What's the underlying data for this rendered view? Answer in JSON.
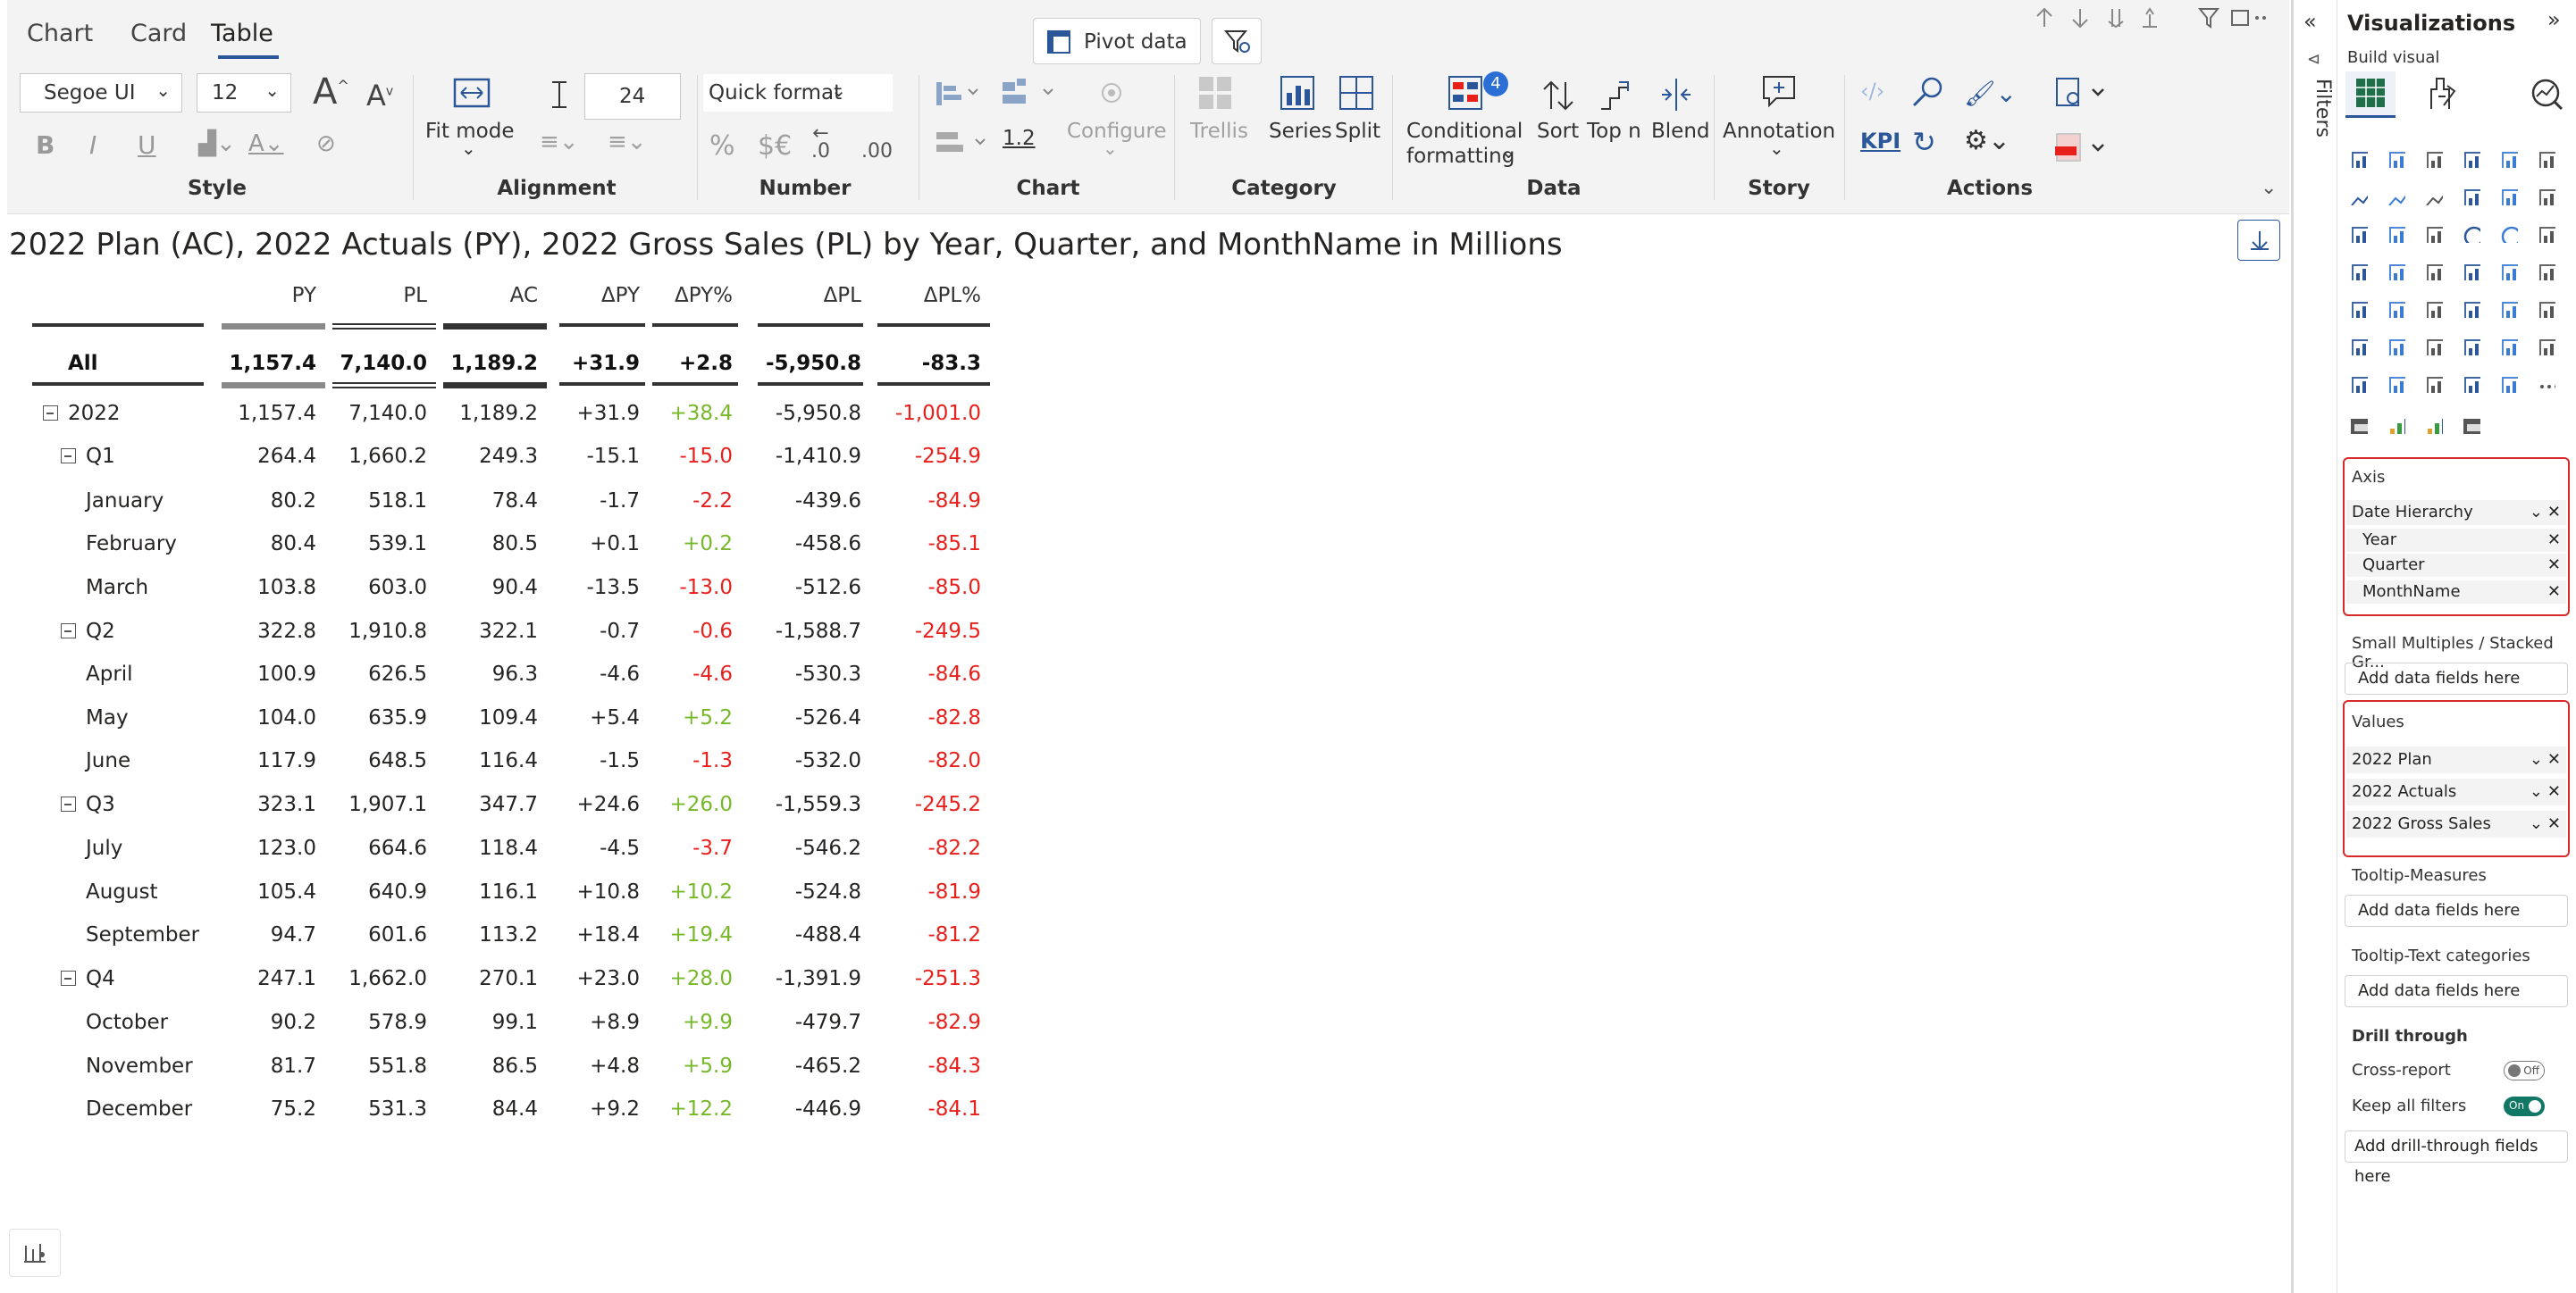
{
  "tabs": [
    "Chart",
    "Card",
    "Table"
  ],
  "active_tab": "Table",
  "top_buttons": {
    "pivot": "Pivot data"
  },
  "ribbon": {
    "style": {
      "font": "Segoe UI",
      "size": "12",
      "group": "Style"
    },
    "alignment": {
      "row_height": "24",
      "fit_mode": "Fit mode",
      "group": "Alignment"
    },
    "number": {
      "quick_format": "Quick format",
      "percent": "%",
      "currency": "$€",
      "dec_dec": ".0",
      "dec_inc": ".00",
      "group": "Number"
    },
    "chart": {
      "scale": "1.2",
      "configure": "Configure",
      "group": "Chart"
    },
    "category": {
      "trellis": "Trellis",
      "series": "Series",
      "split": "Split",
      "group": "Category"
    },
    "data": {
      "conditional": "Conditional",
      "formatting": "formatting",
      "badge": "4",
      "sort": "Sort",
      "topn": "Top n",
      "blend": "Blend",
      "group": "Data"
    },
    "story": {
      "annotation": "Annotation",
      "group": "Story"
    },
    "actions": {
      "kpi": "KPI",
      "group": "Actions"
    }
  },
  "visual_title": "2022 Plan (AC), 2022 Actuals (PY), 2022 Gross Sales (PL) by Year, Quarter, and MonthName in Millions",
  "table": {
    "columns": [
      "PY",
      "PL",
      "AC",
      "ΔPY",
      "ΔPY%",
      "ΔPL",
      "ΔPL%"
    ],
    "rows": [
      {
        "label": "All",
        "level": "total",
        "values": [
          "1,157.4",
          "7,140.0",
          "1,189.2",
          "+31.9",
          "+2.8",
          "-5,950.8",
          "-83.3"
        ]
      },
      {
        "label": "2022",
        "level": "year",
        "values": [
          "1,157.4",
          "7,140.0",
          "1,189.2",
          "+31.9",
          "+38.4",
          "-5,950.8",
          "-1,001.0"
        ]
      },
      {
        "label": "Q1",
        "level": "quarter",
        "values": [
          "264.4",
          "1,660.2",
          "249.3",
          "-15.1",
          "-15.0",
          "-1,410.9",
          "-254.9"
        ]
      },
      {
        "label": "January",
        "level": "month",
        "values": [
          "80.2",
          "518.1",
          "78.4",
          "-1.7",
          "-2.2",
          "-439.6",
          "-84.9"
        ]
      },
      {
        "label": "February",
        "level": "month",
        "values": [
          "80.4",
          "539.1",
          "80.5",
          "+0.1",
          "+0.2",
          "-458.6",
          "-85.1"
        ]
      },
      {
        "label": "March",
        "level": "month",
        "values": [
          "103.8",
          "603.0",
          "90.4",
          "-13.5",
          "-13.0",
          "-512.6",
          "-85.0"
        ]
      },
      {
        "label": "Q2",
        "level": "quarter",
        "values": [
          "322.8",
          "1,910.8",
          "322.1",
          "-0.7",
          "-0.6",
          "-1,588.7",
          "-249.5"
        ]
      },
      {
        "label": "April",
        "level": "month",
        "values": [
          "100.9",
          "626.5",
          "96.3",
          "-4.6",
          "-4.6",
          "-530.3",
          "-84.6"
        ]
      },
      {
        "label": "May",
        "level": "month",
        "values": [
          "104.0",
          "635.9",
          "109.4",
          "+5.4",
          "+5.2",
          "-526.4",
          "-82.8"
        ]
      },
      {
        "label": "June",
        "level": "month",
        "values": [
          "117.9",
          "648.5",
          "116.4",
          "-1.5",
          "-1.3",
          "-532.0",
          "-82.0"
        ]
      },
      {
        "label": "Q3",
        "level": "quarter",
        "values": [
          "323.1",
          "1,907.1",
          "347.7",
          "+24.6",
          "+26.0",
          "-1,559.3",
          "-245.2"
        ]
      },
      {
        "label": "July",
        "level": "month",
        "values": [
          "123.0",
          "664.6",
          "118.4",
          "-4.5",
          "-3.7",
          "-546.2",
          "-82.2"
        ]
      },
      {
        "label": "August",
        "level": "month",
        "values": [
          "105.4",
          "640.9",
          "116.1",
          "+10.8",
          "+10.2",
          "-524.8",
          "-81.9"
        ]
      },
      {
        "label": "September",
        "level": "month",
        "values": [
          "94.7",
          "601.6",
          "113.2",
          "+18.4",
          "+19.4",
          "-488.4",
          "-81.2"
        ]
      },
      {
        "label": "Q4",
        "level": "quarter",
        "values": [
          "247.1",
          "1,662.0",
          "270.1",
          "+23.0",
          "+28.0",
          "-1,391.9",
          "-251.3"
        ]
      },
      {
        "label": "October",
        "level": "month",
        "values": [
          "90.2",
          "578.9",
          "99.1",
          "+8.9",
          "+9.9",
          "-479.7",
          "-82.9"
        ]
      },
      {
        "label": "November",
        "level": "month",
        "values": [
          "81.7",
          "551.8",
          "86.5",
          "+4.8",
          "+5.9",
          "-465.2",
          "-84.3"
        ]
      },
      {
        "label": "December",
        "level": "month",
        "values": [
          "75.2",
          "531.3",
          "84.4",
          "+9.2",
          "+12.2",
          "-446.9",
          "-84.1"
        ]
      }
    ]
  },
  "filters_label": "Filters",
  "viz_pane": {
    "title": "Visualizations",
    "build_visual": "Build visual",
    "axis": {
      "title": "Axis",
      "field": "Date Hierarchy",
      "levels": [
        "Year",
        "Quarter",
        "MonthName"
      ]
    },
    "small_multiples": {
      "title": "Small Multiples / Stacked Gr...",
      "placeholder": "Add data fields here"
    },
    "values": {
      "title": "Values",
      "fields": [
        "2022 Plan",
        "2022 Actuals",
        "2022 Gross Sales"
      ]
    },
    "tooltip_measures": {
      "title": "Tooltip-Measures",
      "placeholder": "Add data fields here"
    },
    "tooltip_text": {
      "title": "Tooltip-Text categories",
      "placeholder": "Add data fields here"
    },
    "drill": {
      "title": "Drill through",
      "cross_report": "Cross-report",
      "cross_state": "Off",
      "keep_filters": "Keep all filters",
      "keep_state": "On",
      "add": "Add drill-through fields here"
    }
  },
  "colors": {
    "positive": "#76b82a",
    "negative": "#e8201c",
    "accent": "#2b579a",
    "highlight": "#d92a2a"
  }
}
